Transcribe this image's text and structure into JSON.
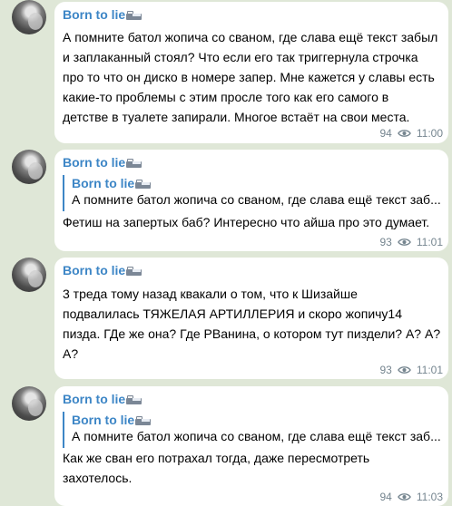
{
  "messages": [
    {
      "sender": "Born to lie",
      "text": "А помните батол жопича со сваном, где слава ещё текст забыл\nи заплаканный стоял? Что если его так триггернула строчка\nпро то что он диско в номере запер. Мне кажется у славы есть\nкакие-то проблемы с этим просле того как его самого в\nдетстве в туалете запирали. Многое встаёт на свои места.",
      "views": "94",
      "time": "11:00"
    },
    {
      "sender": "Born to lie",
      "reply_name": "Born to lie",
      "reply_text": "А помните батол жопича со сваном, где слава ещё текст заб...",
      "text": "Фетиш на запертых баб? Интересно что айша про это думает.",
      "views": "93",
      "time": "11:01"
    },
    {
      "sender": "Born to lie",
      "text": "3 треда тому назад квакали о том, что к Шизайше\nподвалилась ТЯЖЕЛАЯ АРТИЛЛЕРИЯ и скоро жопичу14\nпизда. ГДе же она? Где РВанина, о котором тут пиздели? А? А?\nА?",
      "views": "93",
      "time": "11:01"
    },
    {
      "sender": "Born to lie",
      "reply_name": "Born to lie",
      "reply_text": "А помните батол жопича со сваном, где слава ещё текст заб...",
      "text": "Как же сван его потрахал тогда, даже пересмотреть\nзахотелось.",
      "views": "94",
      "time": "11:03"
    }
  ],
  "icons": {
    "sender_badge": "bed-icon",
    "views": "eye-icon"
  },
  "colors": {
    "background": "#dfe7d7",
    "bubble": "#ffffff",
    "accent": "#3d86c6",
    "meta": "#75858f"
  }
}
